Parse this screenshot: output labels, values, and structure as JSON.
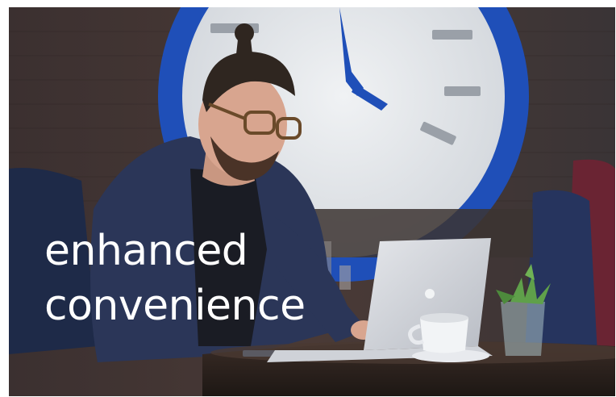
{
  "hero": {
    "headline_line1": "enhanced",
    "headline_line2": "convenience"
  },
  "colors": {
    "text": "#ffffff",
    "clock_rim": "#1f4fb8",
    "clock_face": "#e9ecef",
    "background_dark": "#2a2c33"
  }
}
